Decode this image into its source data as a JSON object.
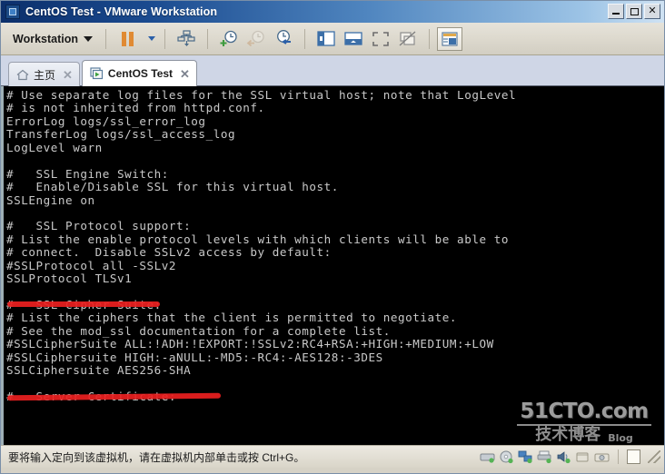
{
  "window": {
    "title": "CentOS Test - VMware Workstation",
    "icon": "vmware-vm-icon",
    "controls": {
      "minimize": "_",
      "maximize": "□",
      "close": "✕"
    }
  },
  "toolbar": {
    "menu_label": "Workstation",
    "menu_caret": "▼",
    "buttons": [
      {
        "name": "suspend-button",
        "icon": "pause-icon"
      },
      {
        "name": "power-dropdown-button",
        "icon": "chevron-down-icon"
      },
      {
        "name": "snapshot-manager-button",
        "icon": "snapshot-tree-icon"
      },
      {
        "name": "take-snapshot-button",
        "icon": "clock-plus-icon"
      },
      {
        "name": "revert-snapshot-button",
        "icon": "clock-back-icon"
      },
      {
        "name": "manage-snapshots-button",
        "icon": "clock-wrench-icon"
      },
      {
        "name": "show-library-button",
        "icon": "sidebar-panel-icon"
      },
      {
        "name": "show-thumbnail-bar-button",
        "icon": "thumbnail-bar-icon"
      },
      {
        "name": "full-screen-button",
        "icon": "fullscreen-icon"
      },
      {
        "name": "unity-mode-button",
        "icon": "unity-windows-icon"
      },
      {
        "name": "console-view-button",
        "icon": "console-view-icon"
      }
    ]
  },
  "tabs": [
    {
      "name": "tab-home",
      "label": "主页",
      "icon": "home-icon",
      "active": false,
      "close": "✕"
    },
    {
      "name": "tab-centos-test",
      "label": "CentOS Test",
      "icon": "vm-icon",
      "active": true,
      "close": "✕"
    }
  ],
  "terminal": {
    "lines": [
      "# Use separate log files for the SSL virtual host; note that LogLevel",
      "# is not inherited from httpd.conf.",
      "ErrorLog logs/ssl_error_log",
      "TransferLog logs/ssl_access_log",
      "LogLevel warn",
      "",
      "#   SSL Engine Switch:",
      "#   Enable/Disable SSL for this virtual host.",
      "SSLEngine on",
      "",
      "#   SSL Protocol support:",
      "# List the enable protocol levels with which clients will be able to",
      "# connect.  Disable SSLv2 access by default:",
      "#SSLProtocol all -SSLv2",
      "SSLProtocol TLSv1",
      "",
      "#   SSL Cipher Suite:",
      "# List the ciphers that the client is permitted to negotiate.",
      "# See the mod_ssl documentation for a complete list.",
      "#SSLCipherSuite ALL:!ADH:!EXPORT:!SSLv2:RC4+RSA:+HIGH:+MEDIUM:+LOW",
      "#SSLCiphersuite HIGH:-aNULL:-MD5:-RC4:-AES128:-3DES",
      "SSLCiphersuite AES256-SHA",
      "",
      "#   Server Certificate:"
    ],
    "annotations": [
      {
        "name": "red-underline-sslprotocol",
        "target": "SSLProtocol TLSv1",
        "color": "#ec2020"
      },
      {
        "name": "red-underline-sslciphersuite",
        "target": "SSLCiphersuite AES256-SHA",
        "color": "#ec2020"
      }
    ],
    "watermark": {
      "main": "51CTO.com",
      "sub_cn": "技术博客",
      "sub_en": "Blog"
    }
  },
  "statusbar": {
    "message": "要将输入定向到该虚拟机，请在虚拟机内部单击或按 Ctrl+G。",
    "icons": [
      {
        "name": "hard-disk-icon"
      },
      {
        "name": "cd-dvd-icon"
      },
      {
        "name": "network-adapter-icon"
      },
      {
        "name": "printer-icon"
      },
      {
        "name": "sound-card-icon"
      },
      {
        "name": "usb-device-icon"
      },
      {
        "name": "camera-icon"
      },
      {
        "name": "message-log-icon"
      }
    ],
    "resize_grip": "resize-grip-icon"
  },
  "colors": {
    "title_gradient_start": "#0c2f6b",
    "title_gradient_end": "#cfe2f3",
    "toolbar_bg": "#ddd9ce",
    "tabbar_bg": "#cfd6e6",
    "terminal_bg": "#000000",
    "terminal_fg": "#c9c9c9",
    "annotation_red": "#ec2020",
    "accent_orange": "#e08a33"
  }
}
